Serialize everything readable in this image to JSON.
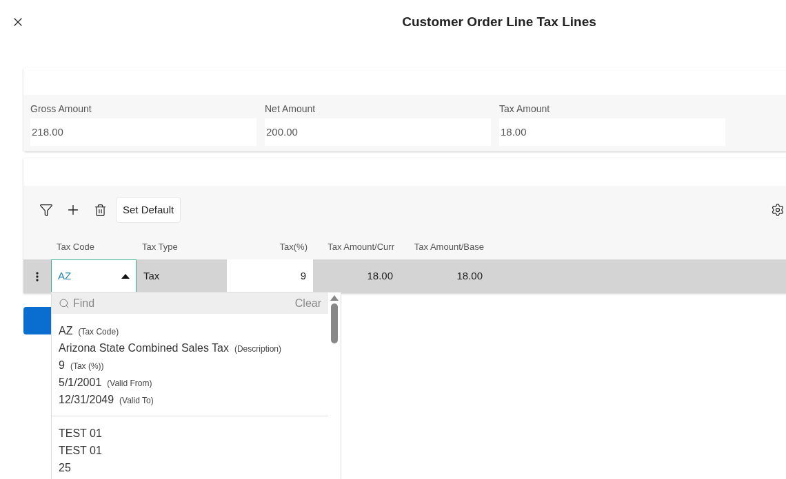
{
  "title": "Customer Order Line Tax Lines",
  "summary": {
    "fields": [
      {
        "label": "Gross Amount",
        "value": "218.00"
      },
      {
        "label": "Net Amount",
        "value": "200.00"
      },
      {
        "label": "Tax Amount",
        "value": "18.00"
      }
    ]
  },
  "toolbar": {
    "set_default": "Set Default"
  },
  "table": {
    "columns": [
      {
        "label": "Tax Code"
      },
      {
        "label": "Tax Type"
      },
      {
        "label": "Tax(%)"
      },
      {
        "label": "Tax Amount/Curr"
      },
      {
        "label": "Tax Amount/Base"
      }
    ],
    "rows": [
      {
        "tax_code": "AZ",
        "tax_type": "Tax",
        "tax_percent": "9",
        "tax_amount_curr": "18.00",
        "tax_amount_base": "18.00",
        "expanded": true
      }
    ]
  },
  "dropdown": {
    "search_placeholder": "Find",
    "clear": "Clear",
    "items": [
      {
        "lines": [
          {
            "text": "AZ",
            "caption": "(Tax Code)"
          },
          {
            "text": "Arizona State Combined Sales Tax",
            "caption": "(Description)"
          },
          {
            "text": "9",
            "caption": "(Tax (%))"
          },
          {
            "text": "5/1/2001",
            "caption": "(Valid From)"
          },
          {
            "text": "12/31/2049",
            "caption": "(Valid To)"
          }
        ]
      },
      {
        "lines": [
          {
            "text": "TEST 01"
          },
          {
            "text": "TEST 01"
          },
          {
            "text": "25"
          }
        ]
      }
    ]
  }
}
